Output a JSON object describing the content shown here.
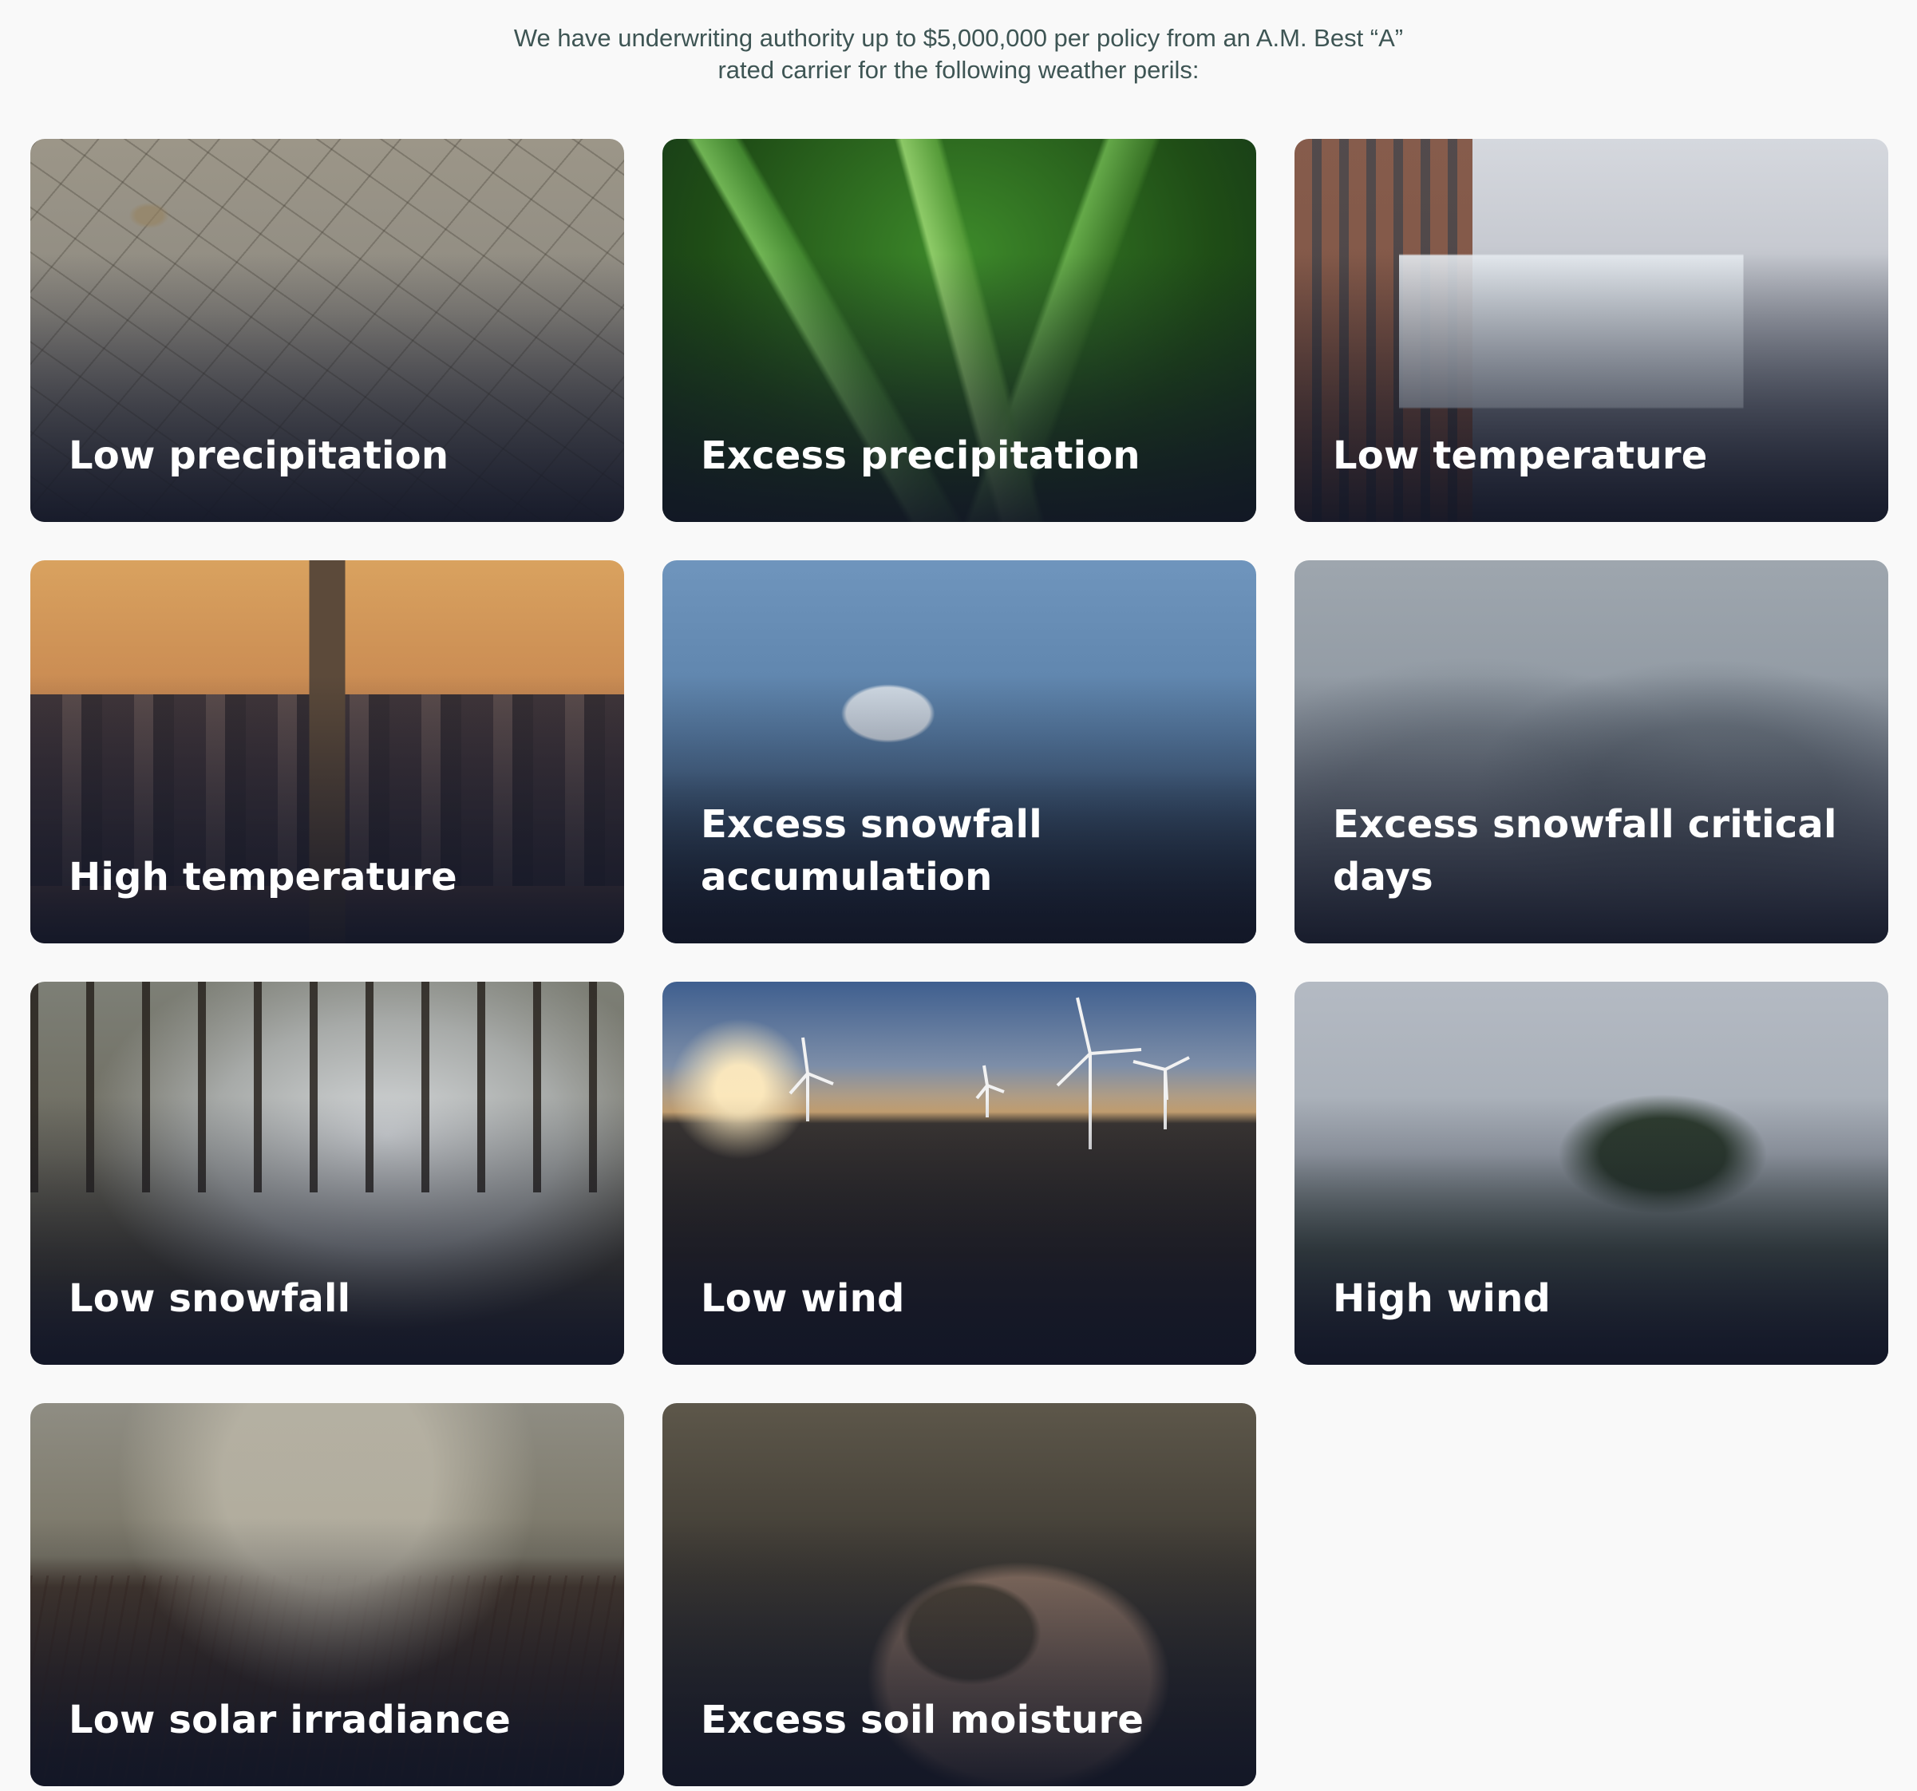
{
  "intro": {
    "line1": "We have underwriting authority up to $5,000,000 per policy from an A.M. Best “A”",
    "line2": "rated carrier for the following weather perils:"
  },
  "perils": [
    {
      "label": "Low precipitation",
      "image": "cracked-dry-soil"
    },
    {
      "label": "Excess precipitation",
      "image": "wet-grass-droplets"
    },
    {
      "label": "Low temperature",
      "image": "frozen-building"
    },
    {
      "label": "High temperature",
      "image": "city-skyline-sunset"
    },
    {
      "label": "Excess snowfall accumulation",
      "image": "snowy-pine-trees"
    },
    {
      "label": "Excess snowfall critical days",
      "image": "snowstorm-mountains"
    },
    {
      "label": "Low snowfall",
      "image": "misty-forest"
    },
    {
      "label": "Low wind",
      "image": "wind-turbines-sunset"
    },
    {
      "label": "High wind",
      "image": "windblown-tree-fog"
    },
    {
      "label": "Low solar irradiance",
      "image": "cloudy-farm-field"
    },
    {
      "label": "Excess soil moisture",
      "image": "hands-holding-soil"
    }
  ]
}
